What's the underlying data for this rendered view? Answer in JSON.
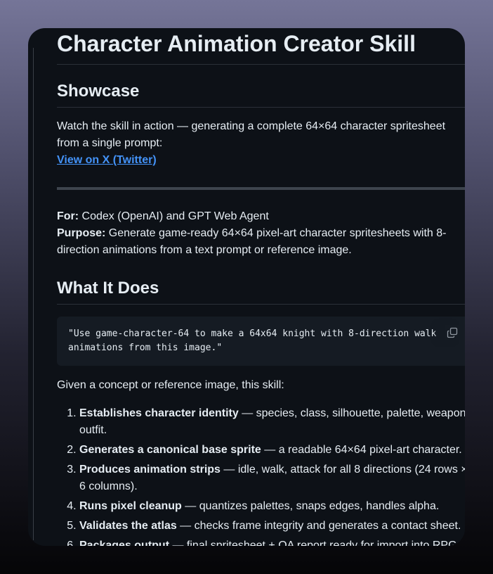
{
  "title": "Character Animation Creator Skill",
  "showcase": {
    "heading": "Showcase",
    "intro": "Watch the skill in action — generating a complete 64×64 character spritesheet from a single prompt:",
    "link_label": "View on X (Twitter)"
  },
  "meta": {
    "for_label": "For:",
    "for_value": " Codex (OpenAI) and GPT Web Agent",
    "purpose_label": "Purpose:",
    "purpose_value": " Generate game-ready 64×64 pixel-art character spritesheets with 8-direction animations from a text prompt or reference image."
  },
  "what_it_does": {
    "heading": "What It Does",
    "code_line1": "\"Use game-character-64 to make a 64x64 knight with 8-direction walk",
    "code_line2": "animations from this image.\"",
    "copy_icon": "copy-icon",
    "given_text": "Given a concept or reference image, this skill:",
    "steps": [
      {
        "bold": "Establishes character identity",
        "rest": " — species, class, silhouette, palette, weapon, outfit."
      },
      {
        "bold": "Generates a canonical base sprite",
        "rest": " — a readable 64×64 pixel-art character."
      },
      {
        "bold": "Produces animation strips",
        "rest": " — idle, walk, attack for all 8 directions (24 rows × 6 columns)."
      },
      {
        "bold": "Runs pixel cleanup",
        "rest": " — quantizes palettes, snaps edges, handles alpha."
      },
      {
        "bold": "Validates the atlas",
        "rest": " — checks frame integrity and generates a contact sheet."
      },
      {
        "bold": "Packages output",
        "rest": " — final spritesheet + QA report ready for import into RPG engines."
      }
    ]
  },
  "colors": {
    "background": "#0d1117",
    "text": "#e6edf3",
    "link": "#4493f8",
    "code_bg": "#151b23"
  }
}
